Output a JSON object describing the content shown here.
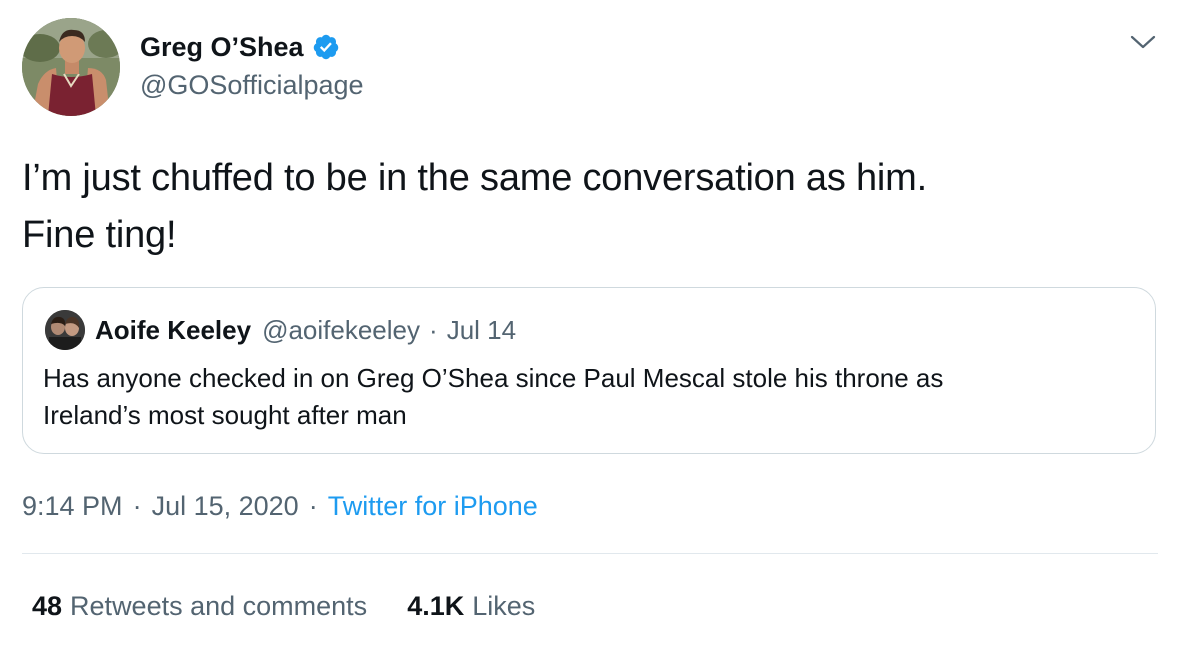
{
  "tweet": {
    "author": {
      "display_name": "Greg O’Shea",
      "handle": "@GOSofficialpage",
      "verified": true
    },
    "text_lines": [
      "I’m just chuffed to be in the same conversation as him.",
      "Fine ting!"
    ],
    "quoted": {
      "display_name": "Aoife Keeley",
      "handle": "@aoifekeeley",
      "separator": "·",
      "date": "Jul 14",
      "text_lines": [
        "Has anyone checked in on Greg O’Shea since Paul Mescal stole his throne as",
        "Ireland’s most sought after man"
      ]
    },
    "meta": {
      "time": "9:14 PM",
      "separator": "·",
      "date": "Jul 15, 2020",
      "source": "Twitter for iPhone"
    },
    "stats": {
      "retweets_count": "48",
      "retweets_label": "Retweets and comments",
      "likes_count": "4.1K",
      "likes_label": "Likes"
    }
  },
  "icons": {
    "verified": "verified-badge-icon",
    "menu": "chevron-down-icon"
  },
  "colors": {
    "accent": "#1d9bf0",
    "text": "#0f1419",
    "secondary": "#536471",
    "border": "#cfd9de"
  }
}
